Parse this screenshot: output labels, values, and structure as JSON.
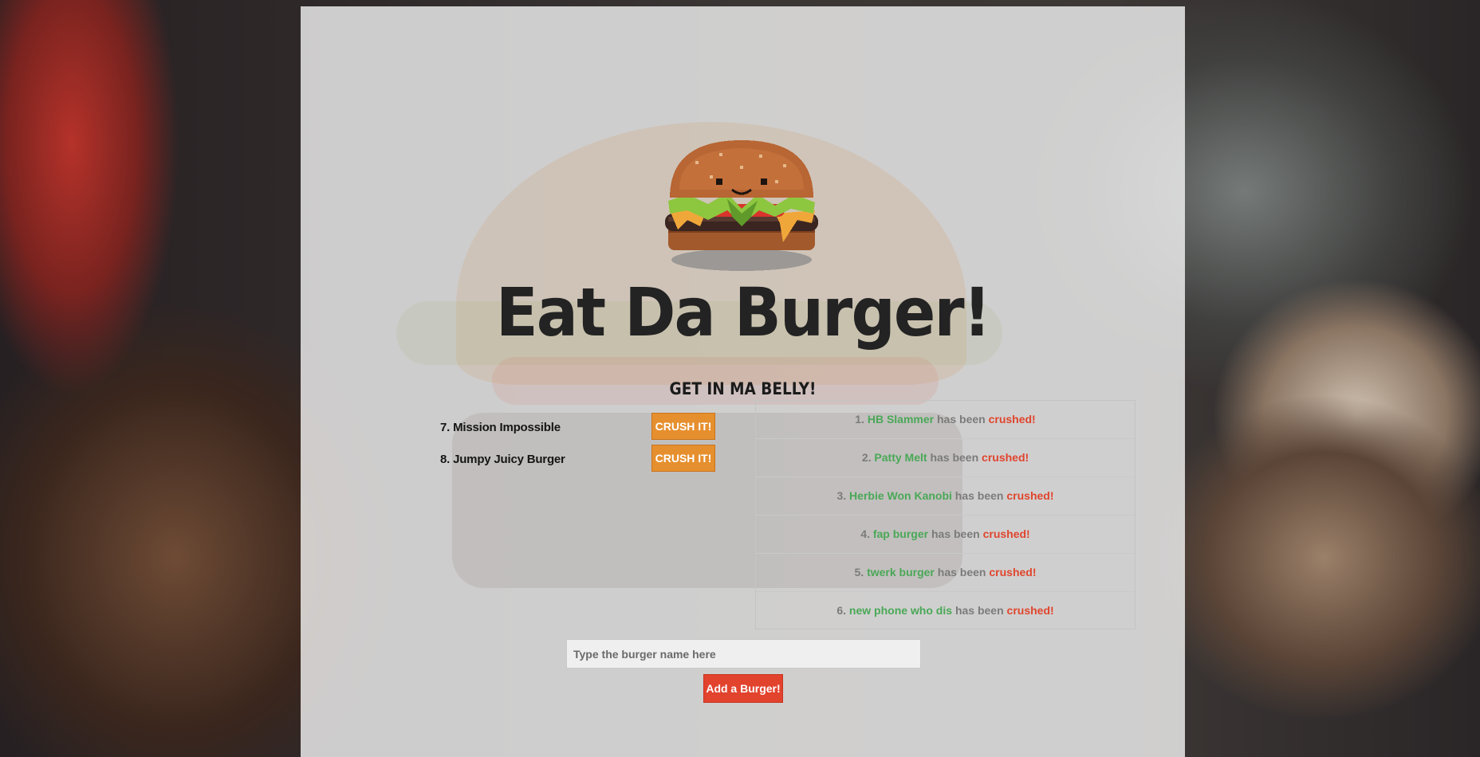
{
  "header": {
    "logo_icon": "pixel-burger-icon",
    "title": "Eat Da Burger!",
    "subtitle": "GET IN MA BELLY!"
  },
  "queue": {
    "items": [
      {
        "label": "7. Mission Impossible",
        "button_label": "CRUSH IT!"
      },
      {
        "label": "8. Jumpy Juicy Burger",
        "button_label": "CRUSH IT!"
      }
    ]
  },
  "devoured": {
    "middle_text": "has been",
    "crushed_text": "crushed!",
    "items": [
      {
        "number": "1.",
        "name": "HB Slammer"
      },
      {
        "number": "2.",
        "name": "Patty Melt"
      },
      {
        "number": "3.",
        "name": "Herbie Won Kanobi"
      },
      {
        "number": "4.",
        "name": "fap burger"
      },
      {
        "number": "5.",
        "name": "twerk burger"
      },
      {
        "number": "6.",
        "name": "new phone who dis"
      }
    ]
  },
  "form": {
    "placeholder": "Type the burger name here",
    "value": "",
    "submit_label": "Add a Burger!"
  },
  "colors": {
    "crush_button": "#e68f2e",
    "add_button": "#e2432d",
    "burger_name": "#4aa857",
    "crushed_word": "#e0452d"
  }
}
